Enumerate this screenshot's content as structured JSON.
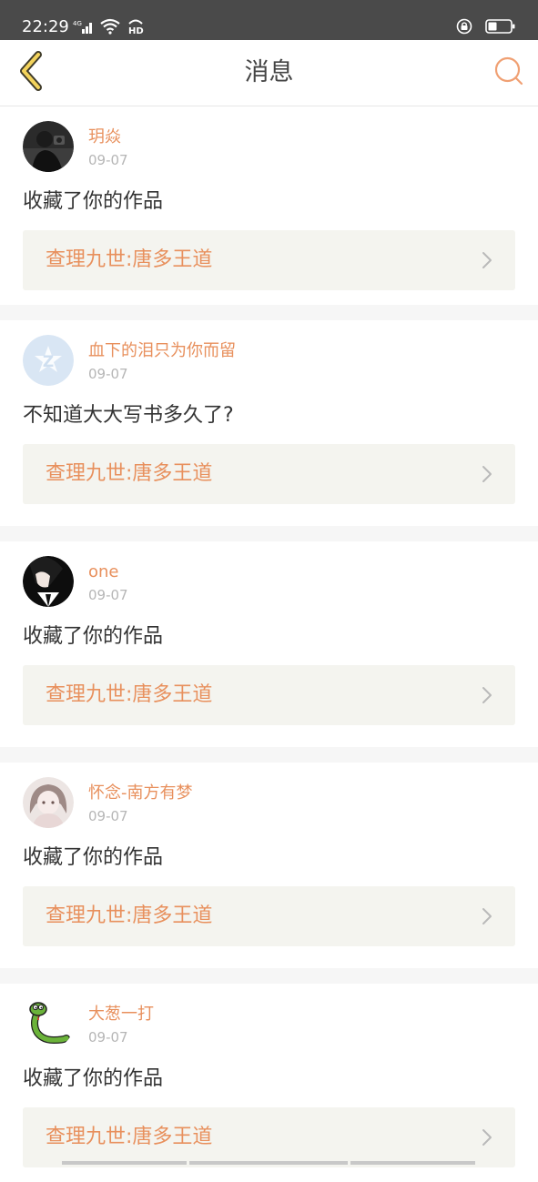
{
  "status_bar": {
    "time": "22:29",
    "network": "4G",
    "hd": "HD",
    "icons": [
      "signal-icon",
      "wifi-icon",
      "hd-icon",
      "rotation-lock-icon",
      "battery-icon"
    ]
  },
  "nav": {
    "title": "消息",
    "back_icon": "back-chevron-icon",
    "search_icon": "search-icon",
    "accent_color": "#e8905d"
  },
  "messages": [
    {
      "name": "玥焱",
      "date": "09-07",
      "text": "收藏了你的作品",
      "work": "查理九世:唐多王道",
      "avatar": "avatar-dark-photo"
    },
    {
      "name": "血下的泪只为你而留",
      "date": "09-07",
      "text": "不知道大大写书多久了?",
      "work": "查理九世:唐多王道",
      "avatar": "avatar-default-z"
    },
    {
      "name": "one",
      "date": "09-07",
      "text": "收藏了你的作品",
      "work": "查理九世:唐多王道",
      "avatar": "avatar-anime-boy"
    },
    {
      "name": "怀念-南方有梦",
      "date": "09-07",
      "text": "收藏了你的作品",
      "work": "查理九世:唐多王道",
      "avatar": "avatar-anime-girl"
    },
    {
      "name": "大葱一打",
      "date": "09-07",
      "text": "收藏了你的作品",
      "work": "查理九世:唐多王道",
      "avatar": "avatar-snake-cartoon"
    }
  ]
}
